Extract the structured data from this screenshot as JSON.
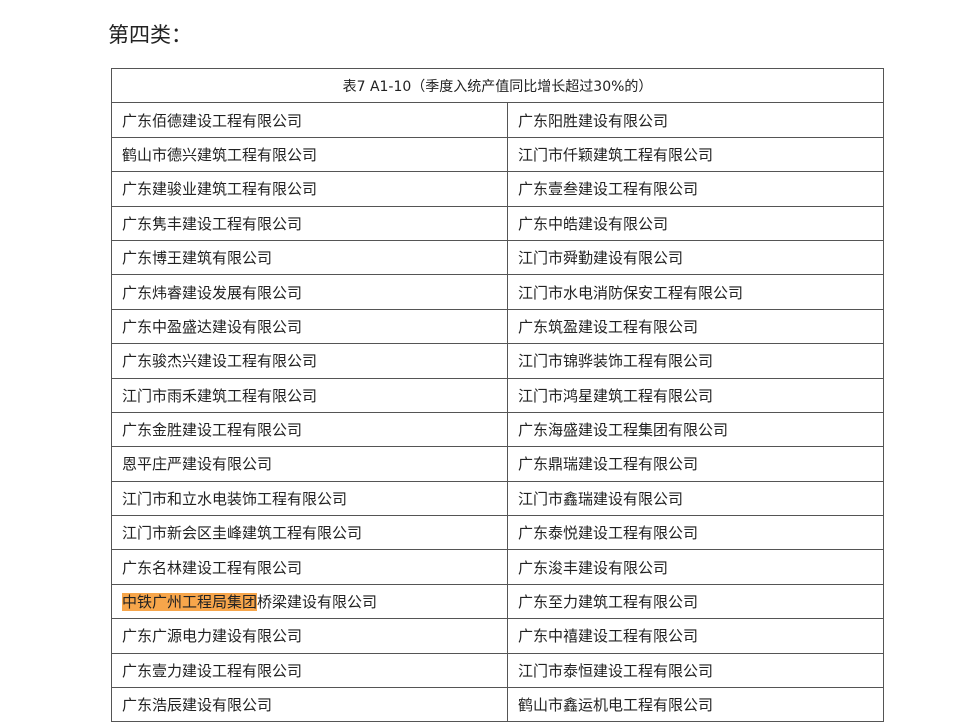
{
  "document": {
    "heading": "第四类：",
    "table_caption": "表7 A1-10（季度入统产值同比增长超过30%的）",
    "highlight_color": "#f7a64b",
    "rows": [
      {
        "left": "广东佰德建设工程有限公司",
        "right": "广东阳胜建设有限公司"
      },
      {
        "left": "鹤山市德兴建筑工程有限公司",
        "right": "江门市仟颖建筑工程有限公司"
      },
      {
        "left": "广东建骏业建筑工程有限公司",
        "right": "广东壹叁建设工程有限公司"
      },
      {
        "left": "广东隽丰建设工程有限公司",
        "right": "广东中皓建设有限公司"
      },
      {
        "left": "广东博王建筑有限公司",
        "right": "江门市舜勤建设有限公司"
      },
      {
        "left": "广东炜睿建设发展有限公司",
        "right": "江门市水电消防保安工程有限公司"
      },
      {
        "left": "广东中盈盛达建设有限公司",
        "right": "广东筑盈建设工程有限公司"
      },
      {
        "left": "广东骏杰兴建设工程有限公司",
        "right": "江门市锦骅装饰工程有限公司"
      },
      {
        "left": "江门市雨禾建筑工程有限公司",
        "right": "江门市鸿星建筑工程有限公司"
      },
      {
        "left": "广东金胜建设工程有限公司",
        "right": "广东海盛建设工程集团有限公司"
      },
      {
        "left": "恩平庄严建设有限公司",
        "right": "广东鼎瑞建设工程有限公司"
      },
      {
        "left": "江门市和立水电装饰工程有限公司",
        "right": "江门市鑫瑞建设有限公司"
      },
      {
        "left": "江门市新会区圭峰建筑工程有限公司",
        "right": "广东泰悦建设工程有限公司"
      },
      {
        "left": "广东名林建设工程有限公司",
        "right": "广东浚丰建设有限公司"
      },
      {
        "left_highlight": "中铁广州工程局集团",
        "left_rest": "桥梁建设有限公司",
        "right": "广东至力建筑工程有限公司"
      },
      {
        "left": "广东广源电力建设有限公司",
        "right": "广东中禧建设工程有限公司"
      },
      {
        "left": "广东壹力建设工程有限公司",
        "right": "江门市泰恒建设工程有限公司"
      },
      {
        "left": "广东浩辰建设有限公司",
        "right": "鹤山市鑫运机电工程有限公司"
      }
    ]
  }
}
